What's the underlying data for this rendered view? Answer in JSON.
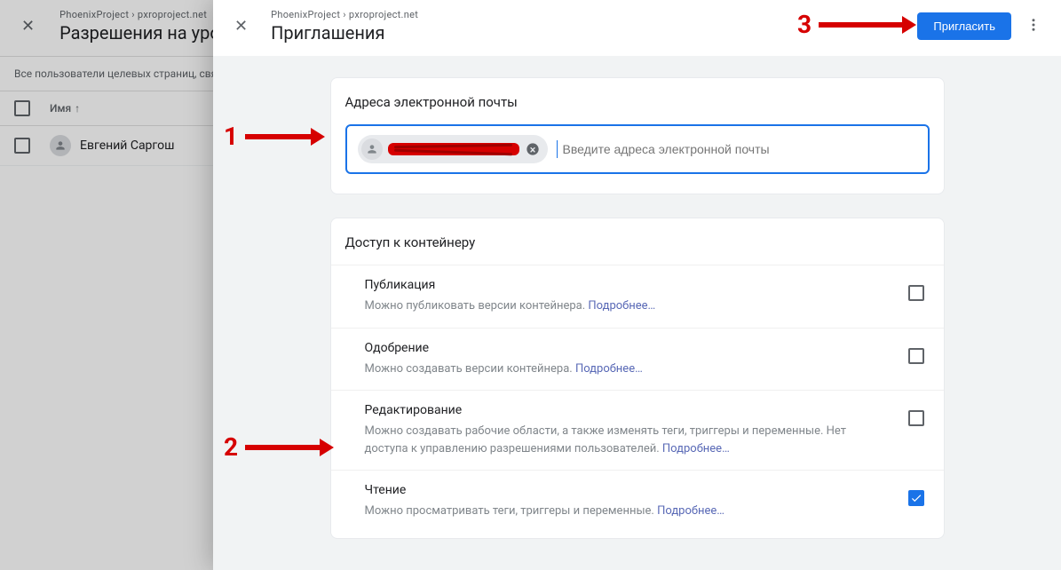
{
  "background": {
    "breadcrumb": "PhoenixProject › pxroproject.net",
    "title": "Разрешения на уров",
    "description": "Все пользователи целевых страниц, свя",
    "nameColumn": "Имя",
    "user": "Евгений Саргош"
  },
  "modal": {
    "breadcrumb": "PhoenixProject › pxroproject.net",
    "title": "Приглашения",
    "inviteButton": "Пригласить"
  },
  "emailCard": {
    "title": "Адреса электронной почты",
    "placeholder": "Введите адреса электронной почты"
  },
  "accessCard": {
    "title": "Доступ к контейнеру",
    "learnMore": "Подробнее…",
    "permissions": [
      {
        "label": "Публикация",
        "desc": "Можно публиковать версии контейнера.",
        "checked": false
      },
      {
        "label": "Одобрение",
        "desc": "Можно создавать версии контейнера.",
        "checked": false
      },
      {
        "label": "Редактирование",
        "desc": "Можно создавать рабочие области, а также изменять теги, триггеры и переменные. Нет доступа к управлению разрешениями пользователей.",
        "checked": false
      },
      {
        "label": "Чтение",
        "desc": "Можно просматривать теги, триггеры и переменные.",
        "checked": true
      }
    ]
  },
  "annotations": {
    "one": "1",
    "two": "2",
    "three": "3"
  }
}
